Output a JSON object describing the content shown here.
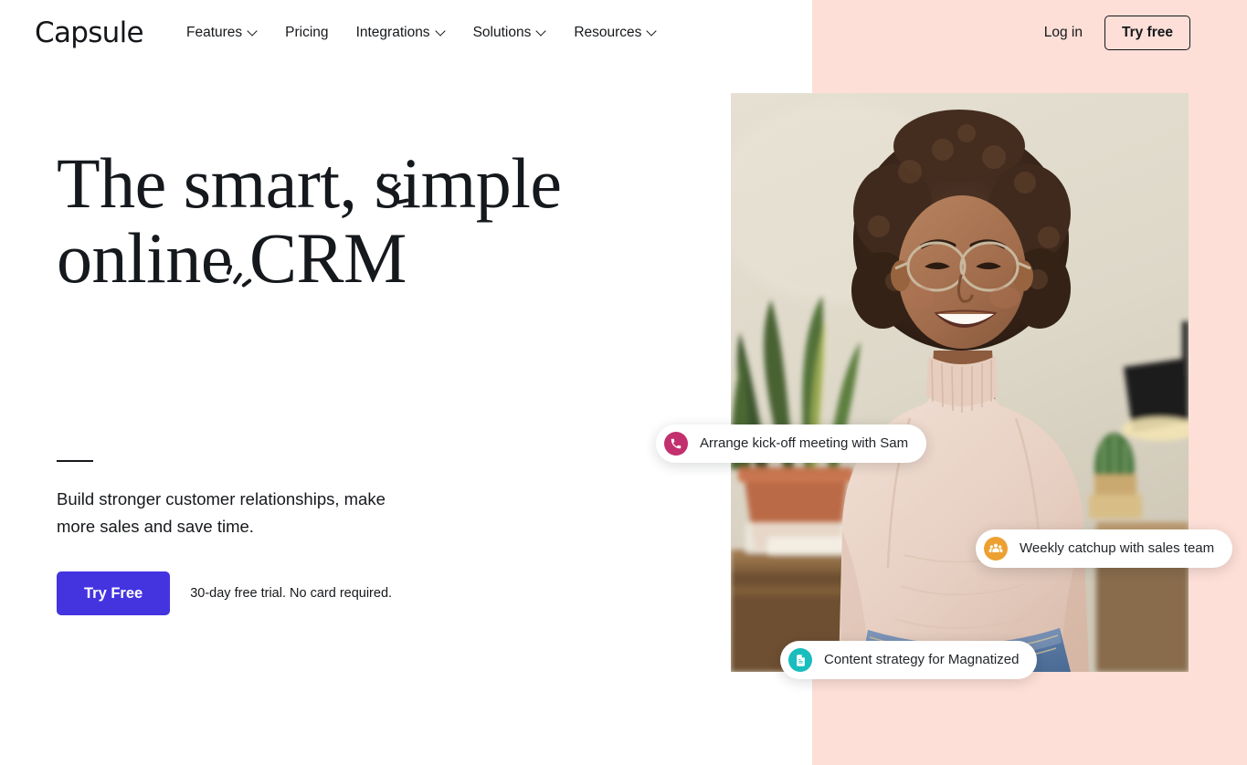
{
  "brand": {
    "name": "Capsule"
  },
  "nav": {
    "items": [
      {
        "label": "Features",
        "has_dropdown": true,
        "icon": "chevron-down-icon"
      },
      {
        "label": "Pricing",
        "has_dropdown": false,
        "icon": ""
      },
      {
        "label": "Integrations",
        "has_dropdown": true,
        "icon": "chevron-down-icon"
      },
      {
        "label": "Solutions",
        "has_dropdown": true,
        "icon": "chevron-down-icon"
      },
      {
        "label": "Resources",
        "has_dropdown": true,
        "icon": "chevron-down-icon"
      }
    ],
    "login_label": "Log in",
    "try_free_label": "Try free"
  },
  "hero": {
    "headline_line1": "The smart, simple",
    "headline_line2": "online CRM",
    "subhead": "Build stronger customer relationships, make more sales and save time.",
    "cta_label": "Try Free",
    "trial_note": "30-day free trial. No card required."
  },
  "pills": [
    {
      "text": "Arrange kick-off meeting with Sam",
      "icon": "phone-icon",
      "color": "#c2306d"
    },
    {
      "text": "Weekly catchup with sales team",
      "icon": "people-group-icon",
      "color": "#eda032"
    },
    {
      "text": "Content strategy for Magnatized",
      "icon": "document-icon",
      "color": "#19bdbd"
    }
  ],
  "photo": {
    "alt": "Smiling woman with curly hair wearing glasses and a cream turtleneck in an office"
  },
  "colors": {
    "pink_panel": "#fddfd7",
    "cta_blue": "#4434e0",
    "text_dark": "#15181c",
    "white": "#ffffff"
  }
}
